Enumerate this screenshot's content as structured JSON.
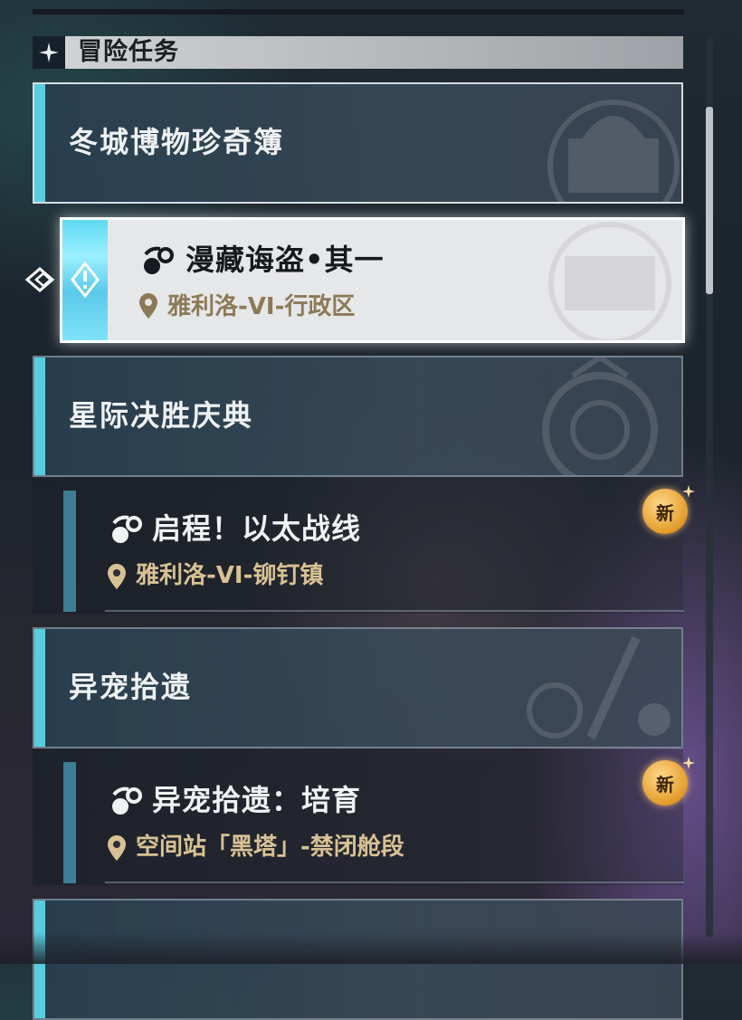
{
  "header": {
    "title": "冒险任务",
    "icon": "sparkle-icon"
  },
  "categories": [
    {
      "title": "冬城博物珍奇簿"
    },
    {
      "title": "星际决胜庆典"
    },
    {
      "title": "异宠拾遗"
    },
    {
      "title": ""
    }
  ],
  "quests": [
    {
      "title": "漫藏诲盗•其一",
      "location": "雅利洛-VI-行政区",
      "selected": true,
      "new": false
    },
    {
      "title": "启程！以太战线",
      "location": "雅利洛-VI-铆钉镇",
      "selected": false,
      "new": true
    },
    {
      "title": "异宠拾遗：培育",
      "location": "空间站「黑塔」-禁闭舱段",
      "selected": false,
      "new": true
    }
  ],
  "badge_label": "新",
  "colors": {
    "accent": "#58cde0",
    "selected_bg": "#e6e7e9",
    "location_gold": "#d8c294",
    "badge": "#e39b2a"
  }
}
